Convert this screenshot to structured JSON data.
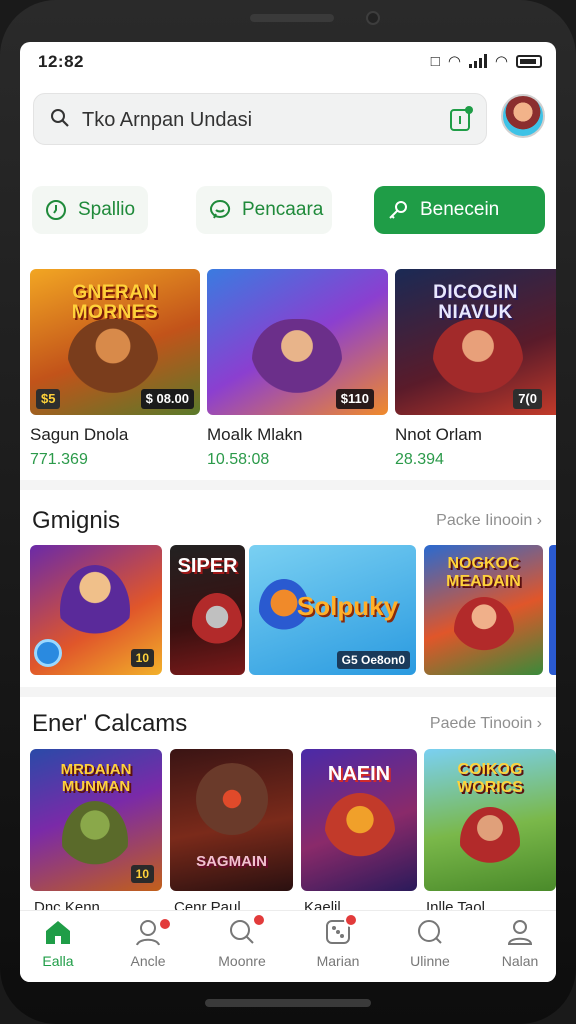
{
  "status": {
    "time": "12:82"
  },
  "search": {
    "placeholder": "Tko Arnpan Undasi"
  },
  "chips": [
    {
      "label": "Spallio",
      "icon": "clock-icon"
    },
    {
      "label": "Pencaara",
      "icon": "chat-icon"
    },
    {
      "label": "Benecein",
      "icon": "key-icon"
    }
  ],
  "featured": [
    {
      "art_title": "GNERAN MORNES",
      "badge": "$5",
      "badge2": "$ 08.00",
      "name": "Sagun Dnola",
      "price": "771.369"
    },
    {
      "art_title": "",
      "badge": "$110",
      "name": "Moalk Mlakn",
      "price": "10.58:08"
    },
    {
      "art_title": "DICOGIN NIAVUK",
      "badge": "7(0",
      "name": "Nnot Orlam",
      "price": "28.394"
    }
  ],
  "section1": {
    "title": "Gmignis",
    "link": "Packe Iinooin"
  },
  "section1_tiles": [
    {
      "title": "",
      "pill": "10"
    },
    {
      "title": "SIPER",
      "pill": ""
    },
    {
      "title": "Solpuky",
      "pill": "G5 Oe8on0"
    },
    {
      "title": "NOGKOC MEADAIN",
      "pill": ""
    }
  ],
  "section2": {
    "title": "Ener' Calcams",
    "link": "Paede Tinooin"
  },
  "section2_tiles": [
    {
      "title": "MRDAIAN MUNMAN",
      "pill": "10",
      "caption": "Dnc Kenn"
    },
    {
      "title": "SAGMAIN",
      "pill": "",
      "caption": "Cenr Paul"
    },
    {
      "title": "NAEIN",
      "pill": "",
      "caption": "Kaelil"
    },
    {
      "title": "COIKOG WORICS",
      "pill": "",
      "caption": "Inlle Taol"
    }
  ],
  "nav": [
    {
      "label": "Ealla",
      "icon": "home-icon",
      "active": true
    },
    {
      "label": "Ancle",
      "icon": "profile-icon"
    },
    {
      "label": "Moonre",
      "icon": "search-icon"
    },
    {
      "label": "Marian",
      "icon": "dice-icon"
    },
    {
      "label": "Ulinne",
      "icon": "search-icon"
    },
    {
      "label": "Nalan",
      "icon": "user-icon"
    }
  ],
  "colors": {
    "accent": "#1f9d47",
    "price": "#2b9a4a",
    "badge": "#e23b3b"
  }
}
